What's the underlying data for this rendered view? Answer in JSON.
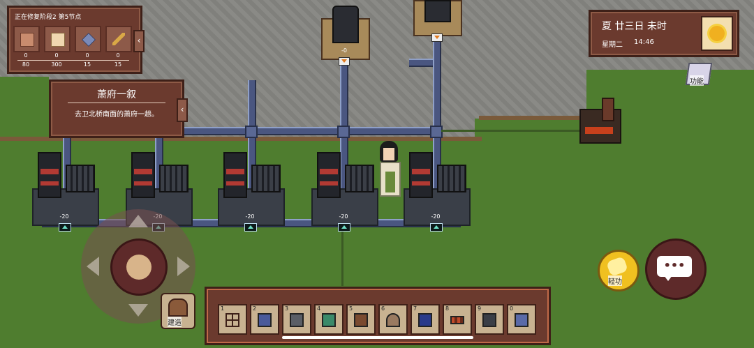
{
  "quest_progress": {
    "title": "正在修复阶段2 第5节点",
    "items": [
      {
        "icon": "wood-plank-icon",
        "have": "0",
        "need": "80"
      },
      {
        "icon": "paper-icon",
        "have": "0",
        "need": "300"
      },
      {
        "icon": "gem-icon",
        "have": "0",
        "need": "15"
      },
      {
        "icon": "brush-icon",
        "have": "0",
        "need": "15"
      }
    ],
    "collapse_glyph": "‹"
  },
  "task": {
    "title": "萧府一叙",
    "description": "去卫北桥南面的萧府一趟。",
    "collapse_glyph": "‹"
  },
  "clock": {
    "season_date": "夏 廿三日 未时",
    "weekday": "星期二",
    "time": "14:46",
    "weather_icon": "sun-icon"
  },
  "function_button": {
    "label": "功能"
  },
  "machines": [
    {
      "value": "-20"
    },
    {
      "value": "-20"
    },
    {
      "value": "-20"
    },
    {
      "value": "-20"
    },
    {
      "value": "-20"
    }
  ],
  "top_machines": [
    {
      "value": "-0"
    },
    {
      "value": ""
    }
  ],
  "build_button": {
    "label": "建造"
  },
  "qinggong_button": {
    "label": "轻功"
  },
  "chat_button": {
    "glyph": "•••"
  },
  "toolbar": {
    "slots": [
      {
        "num": "1",
        "icon": "frame-tile-icon"
      },
      {
        "num": "2",
        "icon": "blue-machine-icon"
      },
      {
        "num": "3",
        "icon": "gray-crate-icon"
      },
      {
        "num": "4",
        "icon": "green-machine-icon"
      },
      {
        "num": "5",
        "icon": "brown-stool-icon"
      },
      {
        "num": "6",
        "icon": "arch-gate-icon"
      },
      {
        "num": "7",
        "icon": "blue-furnace-icon"
      },
      {
        "num": "8",
        "icon": "arrow-belt-icon"
      },
      {
        "num": "9",
        "icon": "dark-stool-icon"
      },
      {
        "num": "0",
        "icon": "teal-machine-icon"
      }
    ]
  },
  "colors": {
    "panel": "#6b3a2e",
    "panel_border": "#3e2018",
    "pipe": "#4a5680",
    "grass": "#4f7d2f",
    "stone": "#8a8a86"
  }
}
